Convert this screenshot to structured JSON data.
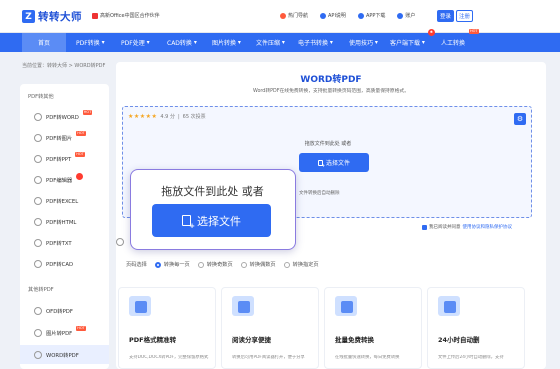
{
  "header": {
    "logo_mark": "Z",
    "logo_text": "转转大师",
    "partner_text": "高新Office中国区合作伙伴",
    "links": [
      {
        "label": "热门导航",
        "icon": "fire-icon",
        "color": "#ff5a3c"
      },
      {
        "label": "API说明",
        "icon": "api-icon",
        "color": "#2f6bf2"
      },
      {
        "label": "APP下载",
        "icon": "phone-icon",
        "color": "#2f6bf2"
      },
      {
        "label": "账户",
        "icon": "user-icon",
        "color": "#2f6bf2"
      }
    ],
    "login_label": "登录",
    "register_label": "注册"
  },
  "nav": {
    "items": [
      "首页",
      "PDF转换",
      "PDF处理",
      "CAD转换",
      "图片转换",
      "文件压缩",
      "电子书转换",
      "使用技巧",
      "客户端下载",
      "人工转换"
    ],
    "active_index": 0,
    "hot_label": "HOT"
  },
  "breadcrumb": "当前位置：转转大师 > WORD转PDF",
  "sidebar": {
    "group1_label": "PDF转其他",
    "group1_items": [
      "PDF转WORD",
      "PDF转图片",
      "PDF转PPT",
      "PDF编辑器",
      "PDF转EXCEL",
      "PDF转HTML",
      "PDF转TXT",
      "PDF转CAD"
    ],
    "group2_label": "其他转PDF",
    "group2_items": [
      "OFD转PDF",
      "图片转PDF",
      "WORD转PDF"
    ],
    "active_item": "WORD转PDF",
    "hot_label": "HOT"
  },
  "main": {
    "title": "WORD转PDF",
    "subtitle": "Word转PDF在线免费转换，支持批量转换页码范围，高质量保持原格式。",
    "rating_score": "4.9 分",
    "rating_count": "65 次投票",
    "stars": "★★★★★",
    "drop_hint": "拖放文件到此处 或者",
    "select_label": "选择文件",
    "privacy_hint": "文件转换后自动删除",
    "agree_text": "我已阅读并同意",
    "agree_link": "使用协议和隐私保护协议",
    "page_range_label": "页码选择",
    "page_range_options": [
      "转换每一页",
      "转换奇数页",
      "转换偶数页",
      "转换指定页"
    ],
    "page_range_selected": 0,
    "cards": [
      {
        "title": "PDF格式精准转",
        "desc": "支持DOC,DOCX转PDF，完整保留原格式"
      },
      {
        "title": "阅读分享便捷",
        "desc": "转换后可用PDF阅读器打开，便于分享"
      },
      {
        "title": "批量免费转换",
        "desc": "在线批量快速转换，每日免费转换"
      },
      {
        "title": "24小时自动删",
        "desc": "文件上传后24小时自动删除，支持"
      }
    ]
  },
  "popup": {
    "drop_hint": "拖放文件到此处 或者",
    "select_label": "选择文件"
  }
}
